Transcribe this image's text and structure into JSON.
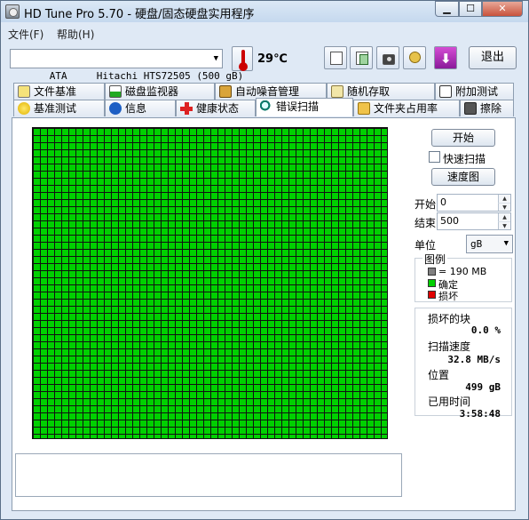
{
  "window": {
    "title": "HD Tune Pro 5.70 - 硬盘/固态硬盘实用程序",
    "min_glyph": "▁",
    "max_glyph": "☐",
    "close_glyph": "✕"
  },
  "menu": [
    {
      "label": "文件(F)"
    },
    {
      "label": "帮助(H)"
    }
  ],
  "toolbar": {
    "drive": "ATA     Hitachi HTS72505 (500 gB)",
    "temperature": "29℃",
    "exit_label": "退出",
    "icons": [
      "copy-text-icon",
      "copy-image-icon",
      "screenshot-icon",
      "options-icon",
      "download-icon"
    ]
  },
  "tabs_top": [
    {
      "label": "文件基准",
      "icon": "file-benchmark-icon"
    },
    {
      "label": "磁盘监视器",
      "icon": "disk-monitor-icon"
    },
    {
      "label": "自动噪音管理",
      "icon": "speaker-icon"
    },
    {
      "label": "随机存取",
      "icon": "random-access-icon"
    },
    {
      "label": "附加测试",
      "icon": "extra-tests-icon"
    }
  ],
  "tabs_bottom": [
    {
      "label": "基准测试",
      "icon": "benchmark-icon"
    },
    {
      "label": "信息",
      "icon": "info-icon"
    },
    {
      "label": "健康状态",
      "icon": "health-icon"
    },
    {
      "label": "错误扫描",
      "icon": "magnifier-icon",
      "active": true
    },
    {
      "label": "文件夹占用率",
      "icon": "folder-icon"
    },
    {
      "label": "擦除",
      "icon": "trash-icon"
    }
  ],
  "error_scan": {
    "start_button": "开始",
    "quick_scan_label": "快速扫描",
    "quick_scan_checked": false,
    "speed_map_button": "速度图",
    "start_label": "开始",
    "start_value": "0",
    "end_label": "结束",
    "end_value": "500",
    "unit_label": "单位",
    "unit_value": "gB",
    "legend": {
      "title": "图例",
      "block_size": "= 190 MB",
      "ok_label": "确定",
      "bad_label": "损坏"
    },
    "colors": {
      "ok": "#00d000",
      "bad": "#e00000",
      "block": "#808080"
    },
    "stats": {
      "damaged_label": "损坏的块",
      "damaged_value": "0.0 %",
      "speed_label": "扫描速度",
      "speed_value": "32.8 MB/s",
      "position_label": "位置",
      "position_value": "499 gB",
      "elapsed_label": "已用时间",
      "elapsed_value": "3:58:48"
    }
  }
}
